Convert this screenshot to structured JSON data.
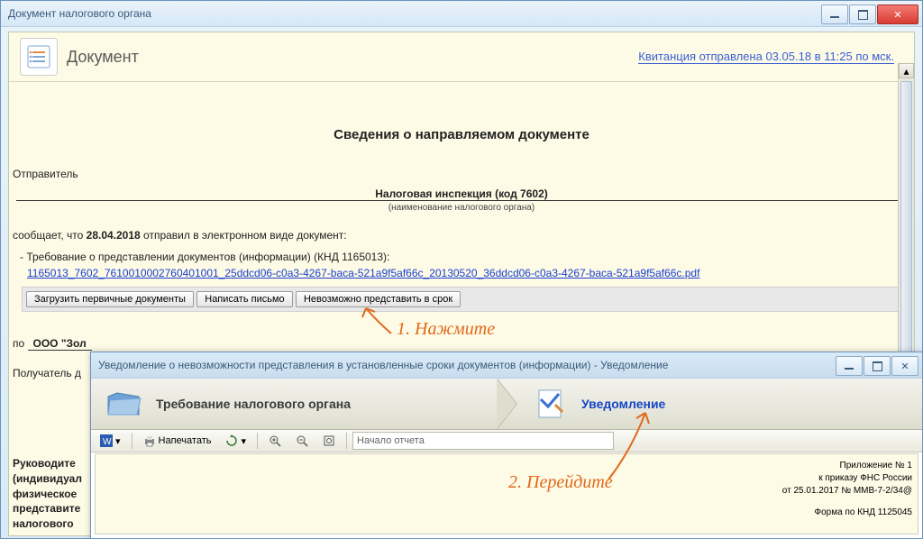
{
  "win1": {
    "title": "Документ налогового органа"
  },
  "doc": {
    "heading": "Документ",
    "receipt_link": "Квитанция отправлена 03.05.18 в 11:25 по мск.",
    "section_title": "Сведения о направляемом документе",
    "sender_label": "Отправитель",
    "sender_name": "Налоговая инспекция (код 7602)",
    "sender_hint": "(наименование налогового органа)",
    "sent_prefix": "сообщает, что ",
    "sent_date": "28.04.2018",
    "sent_suffix": " отправил в электронном виде документ:",
    "request_line": "-  Требование о представлении документов (информации) (КНД 1165013):",
    "filename": "1165013_7602_761001000276040​1001_25ddcd06-c0a3-4267-baca-521a9f5af66c_20130520_36ddcd06-c0a3-4267-baca-521a9f5af66c.pdf",
    "buttons": {
      "load": "Загрузить первичные документы",
      "letter": "Написать письмо",
      "impossible": "Невозможно представить в срок"
    },
    "recipient_prefix": "по  ",
    "recipient_name": "ООО \"Зол",
    "recipient_label": "Получатель д",
    "bottom_lines": [
      "Руководите",
      "(индивидуал",
      "физическое",
      "представите",
      "налогового"
    ]
  },
  "win2": {
    "title": "Уведомление о невозможности представления в установленные сроки документов (информации) - Уведомление",
    "step1": "Требование налогового органа",
    "step2": "Уведомление",
    "toolbar": {
      "print": "Напечатать",
      "search_placeholder": "Начало отчета"
    },
    "report": {
      "line1": "Приложение № 1",
      "line2": "к приказу ФНС России",
      "line3": "от 25.01.2017 № ММВ-7-2/34@",
      "line4": "Форма по КНД 1125045"
    }
  },
  "annotations": {
    "a1": "1. Нажмите",
    "a2": "2. Перейдите"
  }
}
